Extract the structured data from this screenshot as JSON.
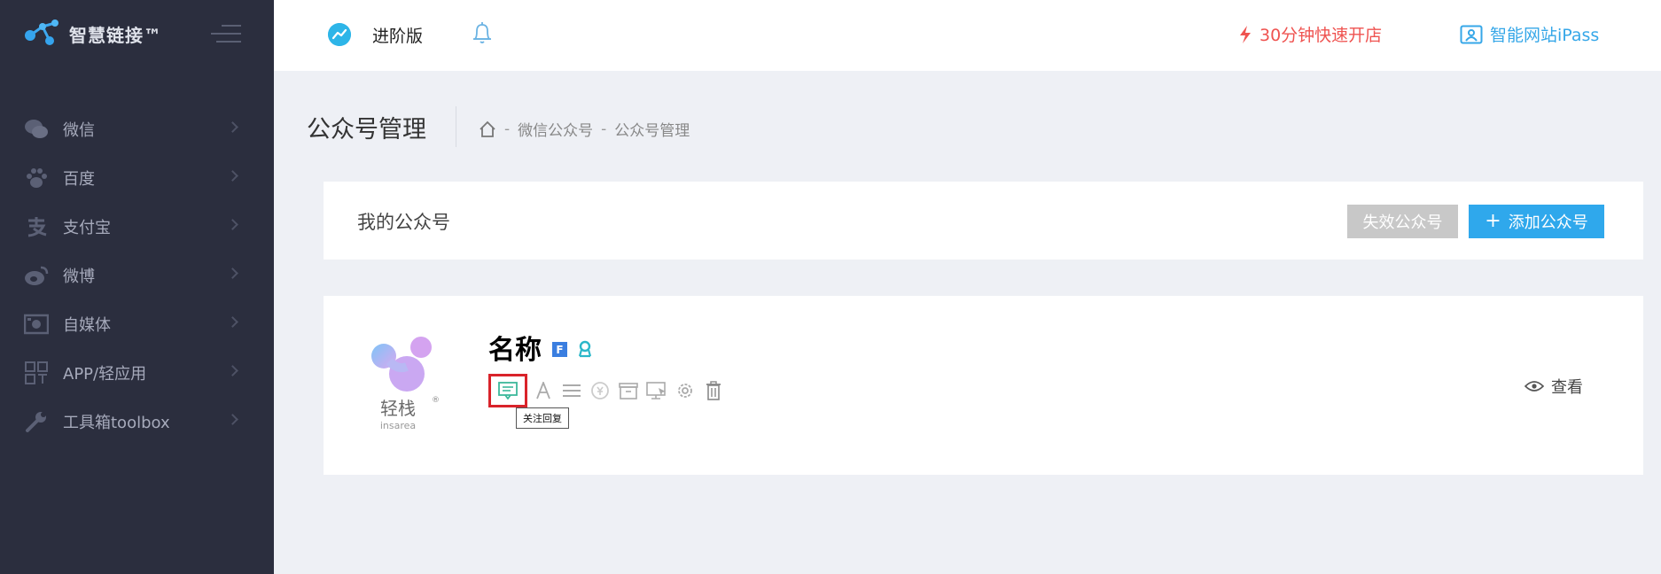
{
  "brand": {
    "name": "智慧链接™"
  },
  "sidebar": {
    "items": [
      {
        "label": "微信",
        "icon": "wechat-icon"
      },
      {
        "label": "百度",
        "icon": "paw-icon"
      },
      {
        "label": "支付宝",
        "icon": "alipay-icon"
      },
      {
        "label": "微博",
        "icon": "weibo-icon"
      },
      {
        "label": "自媒体",
        "icon": "media-icon"
      },
      {
        "label": "APP/轻应用",
        "icon": "app-grid-icon"
      },
      {
        "label": "工具箱toolbox",
        "icon": "wrench-icon"
      }
    ]
  },
  "topbar": {
    "edition": "进阶版",
    "quick_open": "30分钟快速开店",
    "ipass": "智能网站iPass"
  },
  "page": {
    "title": "公众号管理",
    "breadcrumb": [
      "微信公众号",
      "公众号管理"
    ]
  },
  "accounts_card": {
    "title": "我的公众号",
    "inactive_button": "失效公众号",
    "add_button": "添加公众号"
  },
  "account": {
    "name": "名称",
    "badge_f": "F",
    "logo_text": "轻栈",
    "logo_sub": "insarea",
    "tooltip": "关注回复",
    "view_label": "查看"
  },
  "colors": {
    "sidebar_bg": "#2b2e3e",
    "accent_blue": "#2fa8ec",
    "alert_red": "#ef5350",
    "highlight_red": "#d9232a"
  }
}
